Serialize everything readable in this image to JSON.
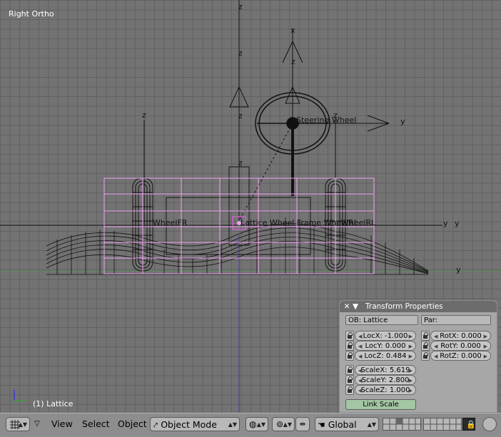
{
  "viewport": {
    "view_name": "Right Ortho",
    "status": "(1) Lattice",
    "axis_labels": {
      "z": "z",
      "y": "y",
      "x": "x"
    },
    "object_names": {
      "steering": "Steering Wheel",
      "wheel_fr": "WheelFR",
      "center": "Lattice  Wheel Frame  WheelRL",
      "wheel_rl": "WheelRL"
    }
  },
  "transform_panel": {
    "title": "Transform Properties",
    "ob_field": "OB: Lattice",
    "par_field": "Par:",
    "loc": [
      "LocX: -1.000",
      "LocY: 0.000",
      "LocZ: 0.484"
    ],
    "rot": [
      "RotX: 0.000",
      "RotY: 0.000",
      "RotZ: 0.000"
    ],
    "scale": [
      "ScaleX: 5.619",
      "ScaleY: 2.800",
      "ScaleZ: 1.000"
    ],
    "link_scale": "Link Scale"
  },
  "header": {
    "menus": [
      "View",
      "Select",
      "Object"
    ],
    "mode": "Object Mode",
    "orientation": "Global"
  },
  "colors": {
    "viewport_bg": "#737373",
    "lattice": "#f0a0f0",
    "wire": "#000000",
    "panel_bg": "#a7a7a7",
    "header_bg": "#8d8d8d"
  },
  "icons": [
    "window-type-icon",
    "triangle-menu-icon",
    "mode-icon",
    "draw-type-icon",
    "pivot-icon",
    "hand-icon",
    "lock-icon",
    "render-icon",
    "close-icon",
    "collapse-icon"
  ]
}
